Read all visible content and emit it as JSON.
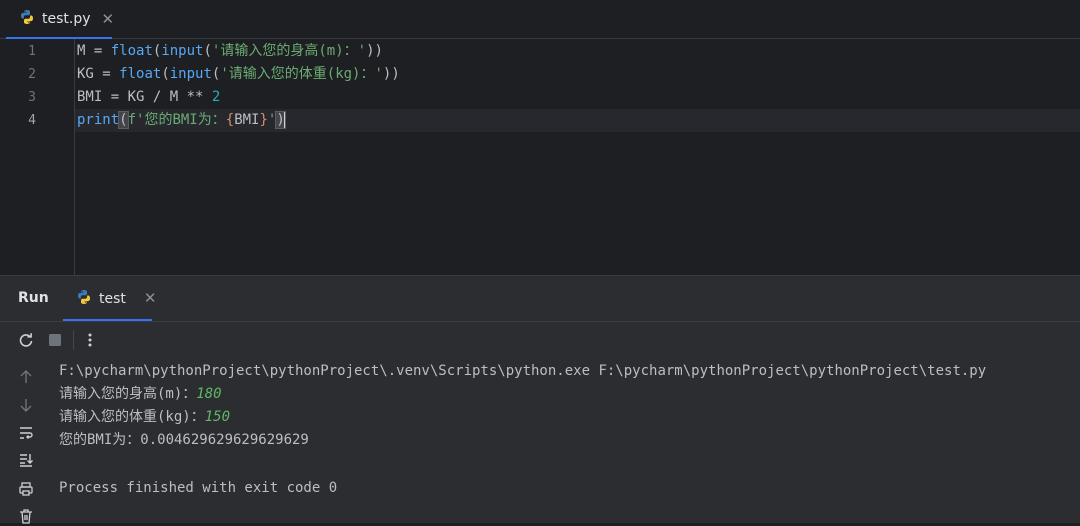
{
  "editor_tab": {
    "filename": "test.py",
    "close_glyph": "✕",
    "icon": "python-icon"
  },
  "editor": {
    "line_numbers": [
      "1",
      "2",
      "3",
      "4"
    ],
    "lines": [
      {
        "var": "M",
        "eq": " = ",
        "f1": "float",
        "p1": "(",
        "f2": "input",
        "p2": "(",
        "str": "'请输入您的身高(m)：'",
        "close": "))"
      },
      {
        "var": "KG",
        "eq": " = ",
        "f1": "float",
        "p1": "(",
        "f2": "input",
        "p2": "(",
        "str": "'请输入您的体重(kg)：'",
        "close": "))"
      },
      {
        "pre": "BMI = KG / M ** ",
        "num": "2"
      },
      {
        "fn": "print",
        "open": "(",
        "fprefix": "f'您的BMI为：",
        "brace_open": "{",
        "expr": "BMI",
        "brace_close": "}",
        "fsuffix": "'",
        "close": ")"
      }
    ]
  },
  "run_panel": {
    "title": "Run",
    "tab_label": "test",
    "tab_close": "✕",
    "toolbar": [
      "rerun-icon",
      "stop-icon",
      "more-vertical-icon"
    ],
    "side_tools": [
      "arrow-up-icon",
      "arrow-down-icon",
      "soft-wrap-icon",
      "scroll-to-end-icon",
      "print-icon",
      "trash-icon"
    ]
  },
  "console": {
    "command": "F:\\pycharm\\pythonProject\\pythonProject\\.venv\\Scripts\\python.exe F:\\pycharm\\pythonProject\\pythonProject\\test.py",
    "prompt_height": "请输入您的身高(m)：",
    "value_height": "180",
    "prompt_weight": "请输入您的体重(kg)：",
    "value_weight": "150",
    "result": "您的BMI为：0.004629629629629629",
    "exit_message": "Process finished with exit code 0"
  },
  "colors": {
    "accent": "#3574f0",
    "string": "#6aab73",
    "function": "#56a8f5",
    "number": "#2aacb8",
    "input": "#5fb865"
  }
}
